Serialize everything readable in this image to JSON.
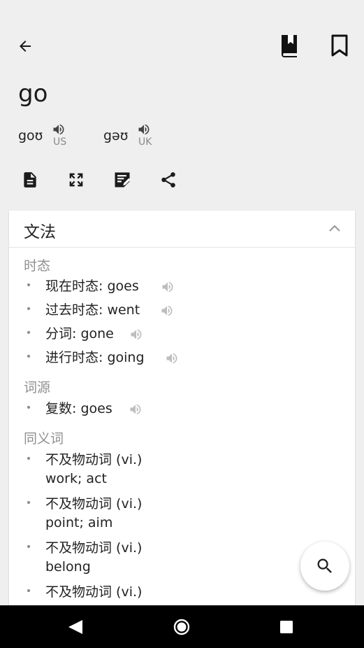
{
  "header": {
    "word": "go",
    "pronunciations": [
      {
        "ipa": "goʊ",
        "region": "US"
      },
      {
        "ipa": "gəʊ",
        "region": "UK"
      }
    ]
  },
  "icons": {
    "back": "arrow-left-icon",
    "wordbook": "book-bookmark-icon",
    "bookmark": "bookmark-outline-icon",
    "document": "document-icon",
    "fullscreen": "fullscreen-icon",
    "note": "edit-note-icon",
    "share": "share-icon",
    "search": "search-icon"
  },
  "grammar": {
    "title": "文法",
    "sections": [
      {
        "title": "时态",
        "items": [
          {
            "label": "现在时态:",
            "value": "goes"
          },
          {
            "label": "过去时态:",
            "value": "went"
          },
          {
            "label": "分词:",
            "value": "gone"
          },
          {
            "label": "进行时态:",
            "value": "going"
          }
        ]
      },
      {
        "title": "词源",
        "items": [
          {
            "label": "复数:",
            "value": "goes"
          }
        ]
      },
      {
        "title": "同义词",
        "items": [
          {
            "label": "不及物动词 (vi.)",
            "value": "work; act"
          },
          {
            "label": "不及物动词 (vi.)",
            "value": "point; aim"
          },
          {
            "label": "不及物动词 (vi.)",
            "value": "belong"
          },
          {
            "label": "不及物动词 (vi.)",
            "value": ""
          }
        ]
      }
    ]
  },
  "colors": {
    "background": "#efefef",
    "card": "#ffffff",
    "section_title": "#8f8f8f",
    "navbar": "#000000"
  }
}
